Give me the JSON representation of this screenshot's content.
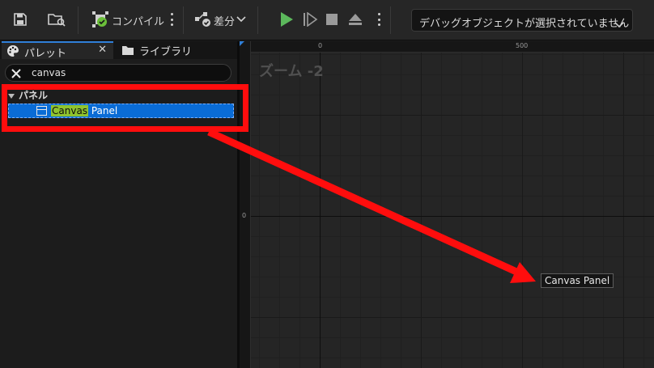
{
  "toolbar": {
    "compile_label": "コンパイル",
    "diff_label": "差分",
    "debug_object": "デバッグオブジェクトが選択されていません"
  },
  "icons": {
    "save": "save-icon",
    "browse": "browse-icon",
    "compile": "compile-icon",
    "diff": "diff-icon",
    "play": "play-icon",
    "step": "step-icon",
    "stop": "stop-icon",
    "eject": "eject-icon"
  },
  "colors": {
    "accent": "#2f7fd8",
    "play": "#5cb85c",
    "selection": "#0a6cd6",
    "highlight_match": "#8fc32e",
    "annotation": "#ff0d0d"
  },
  "tabs": [
    {
      "label": "パレット"
    },
    {
      "label": "ライブラリ"
    }
  ],
  "search": {
    "value": "canvas"
  },
  "palette": {
    "category": "パネル",
    "item": {
      "match": "Canvas",
      "rest": " Panel"
    }
  },
  "canvas": {
    "zoom_label": "ズーム -2",
    "ruler_x": [
      "0",
      "500"
    ],
    "ruler_y": [
      "0"
    ],
    "drag_tooltip": "Canvas Panel"
  }
}
